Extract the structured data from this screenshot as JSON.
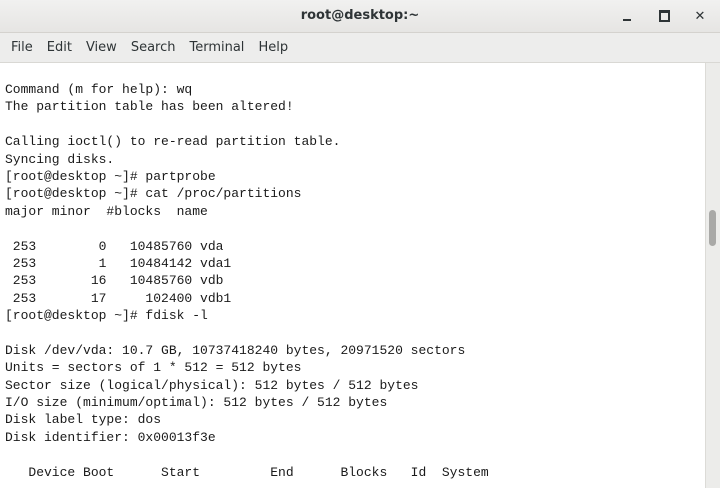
{
  "window": {
    "title": "root@desktop:~",
    "minimize_label": "minimize",
    "maximize_label": "maximize",
    "close_glyph": "✕"
  },
  "menu": [
    {
      "label": "File"
    },
    {
      "label": "Edit"
    },
    {
      "label": "View"
    },
    {
      "label": "Search"
    },
    {
      "label": "Terminal"
    },
    {
      "label": "Help"
    }
  ],
  "terminal": {
    "lines": [
      "Command (m for help): wq",
      "The partition table has been altered!",
      "",
      "Calling ioctl() to re-read partition table.",
      "Syncing disks.",
      "[root@desktop ~]# partprobe",
      "[root@desktop ~]# cat /proc/partitions",
      "major minor  #blocks  name",
      "",
      " 253        0   10485760 vda",
      " 253        1   10484142 vda1",
      " 253       16   10485760 vdb",
      " 253       17     102400 vdb1",
      "[root@desktop ~]# fdisk -l",
      "",
      "Disk /dev/vda: 10.7 GB, 10737418240 bytes, 20971520 sectors",
      "Units = sectors of 1 * 512 = 512 bytes",
      "Sector size (logical/physical): 512 bytes / 512 bytes",
      "I/O size (minimum/optimal): 512 bytes / 512 bytes",
      "Disk label type: dos",
      "Disk identifier: 0x00013f3e",
      "",
      "   Device Boot      Start         End      Blocks   Id  System"
    ]
  },
  "colors": {
    "text": "#1a1a1a",
    "background": "#ffffff",
    "chrome": "#ededec"
  }
}
